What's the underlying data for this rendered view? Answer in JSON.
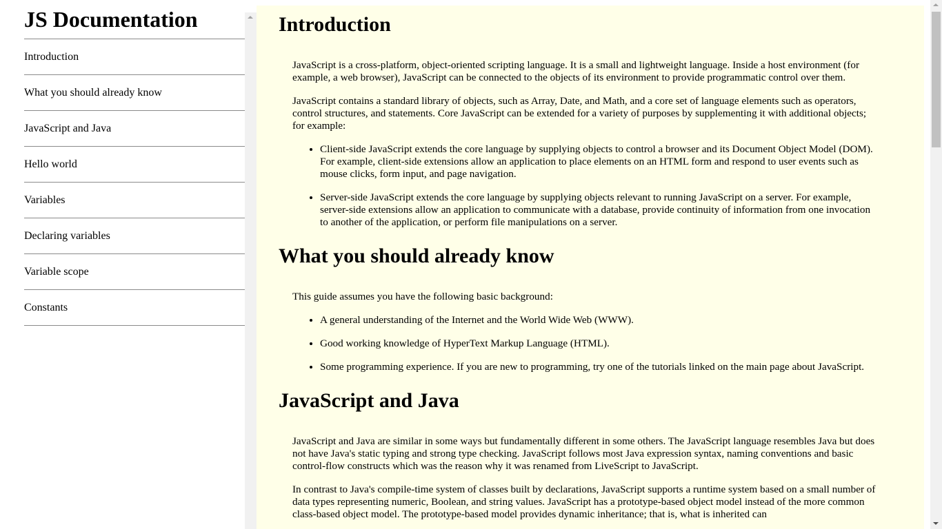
{
  "nav": {
    "title": "JS Documentation",
    "items": [
      {
        "label": "Introduction"
      },
      {
        "label": "What you should already know"
      },
      {
        "label": "JavaScript and Java"
      },
      {
        "label": "Hello world"
      },
      {
        "label": "Variables"
      },
      {
        "label": "Declaring variables"
      },
      {
        "label": "Variable scope"
      },
      {
        "label": "Constants"
      }
    ]
  },
  "sections": {
    "introduction": {
      "header": "Introduction",
      "p1": "JavaScript is a cross-platform, object-oriented scripting language. It is a small and lightweight language. Inside a host environment (for example, a web browser), JavaScript can be connected to the objects of its environment to provide programmatic control over them.",
      "p2": "JavaScript contains a standard library of objects, such as Array, Date, and Math, and a core set of language elements such as operators, control structures, and statements. Core JavaScript can be extended for a variety of purposes by supplementing it with additional objects; for example:",
      "bullets": [
        "Client-side JavaScript extends the core language by supplying objects to control a browser and its Document Object Model (DOM). For example, client-side extensions allow an application to place elements on an HTML form and respond to user events such as mouse clicks, form input, and page navigation.",
        "Server-side JavaScript extends the core language by supplying objects relevant to running JavaScript on a server. For example, server-side extensions allow an application to communicate with a database, provide continuity of information from one invocation to another of the application, or perform file manipulations on a server."
      ]
    },
    "already_know": {
      "header": "What you should already know",
      "p1": "This guide assumes you have the following basic background:",
      "bullets": [
        "A general understanding of the Internet and the World Wide Web (WWW).",
        "Good working knowledge of HyperText Markup Language (HTML).",
        "Some programming experience. If you are new to programming, try one of the tutorials linked on the main page about JavaScript."
      ]
    },
    "js_and_java": {
      "header": "JavaScript and Java",
      "p1": "JavaScript and Java are similar in some ways but fundamentally different in some others. The JavaScript language resembles Java but does not have Java's static typing and strong type checking. JavaScript follows most Java expression syntax, naming conventions and basic control-flow constructs which was the reason why it was renamed from LiveScript to JavaScript.",
      "p2": "In contrast to Java's compile-time system of classes built by declarations, JavaScript supports a runtime system based on a small number of data types representing numeric, Boolean, and string values. JavaScript has a prototype-based object model instead of the more common class-based object model. The prototype-based model provides dynamic inheritance; that is, what is inherited can"
    }
  }
}
